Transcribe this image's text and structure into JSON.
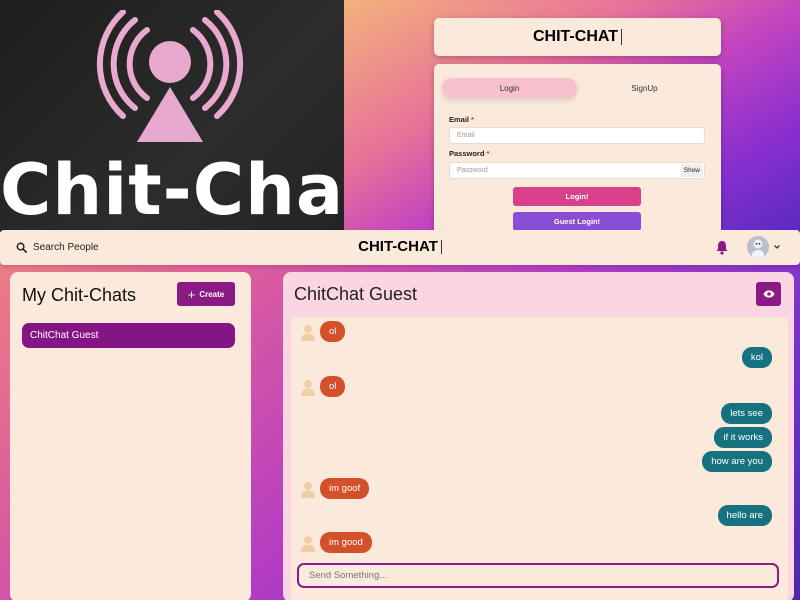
{
  "logo": {
    "text": "Chit-Chat",
    "icon": "broadcast-person-icon",
    "color": "#e8a9cf"
  },
  "login_preview": {
    "title": "CHIT-CHAT",
    "tabs": [
      "Login",
      "SignUp"
    ],
    "email_label": "Email",
    "email_placeholder": "Email",
    "password_label": "Password",
    "password_placeholder": "Password",
    "show_label": "Show",
    "login_button": "Login!",
    "guest_button": "Guest Login!",
    "required_mark": "*"
  },
  "header": {
    "search_label": "Search People",
    "title": "CHIT-CHAT",
    "search_icon": "search-icon",
    "bell_icon": "bell-icon",
    "chevron_icon": "chevron-down-icon"
  },
  "chats": {
    "title": "My Chit-Chats",
    "create_label": "Create",
    "items": [
      "ChitChat Guest"
    ]
  },
  "conversation": {
    "name": "ChitChat Guest",
    "eye_icon": "eye-icon",
    "messages": [
      {
        "side": "in",
        "text": "ol"
      },
      {
        "side": "out",
        "text": "kol"
      },
      {
        "side": "in",
        "text": "ol"
      },
      {
        "side": "out",
        "text": "lets see"
      },
      {
        "side": "out",
        "text": "if it works"
      },
      {
        "side": "out",
        "text": "how are you"
      },
      {
        "side": "in",
        "text": "im goof"
      },
      {
        "side": "out",
        "text": "hello are"
      },
      {
        "side": "in",
        "text": "im good"
      }
    ],
    "input_placeholder": "Send Something..."
  },
  "colors": {
    "primary": "#8c1a85",
    "incoming_bubble": "#d4502a",
    "outgoing_bubble": "#177280",
    "panel": "#fbeadb",
    "chat_panel": "#fbd6e2"
  }
}
